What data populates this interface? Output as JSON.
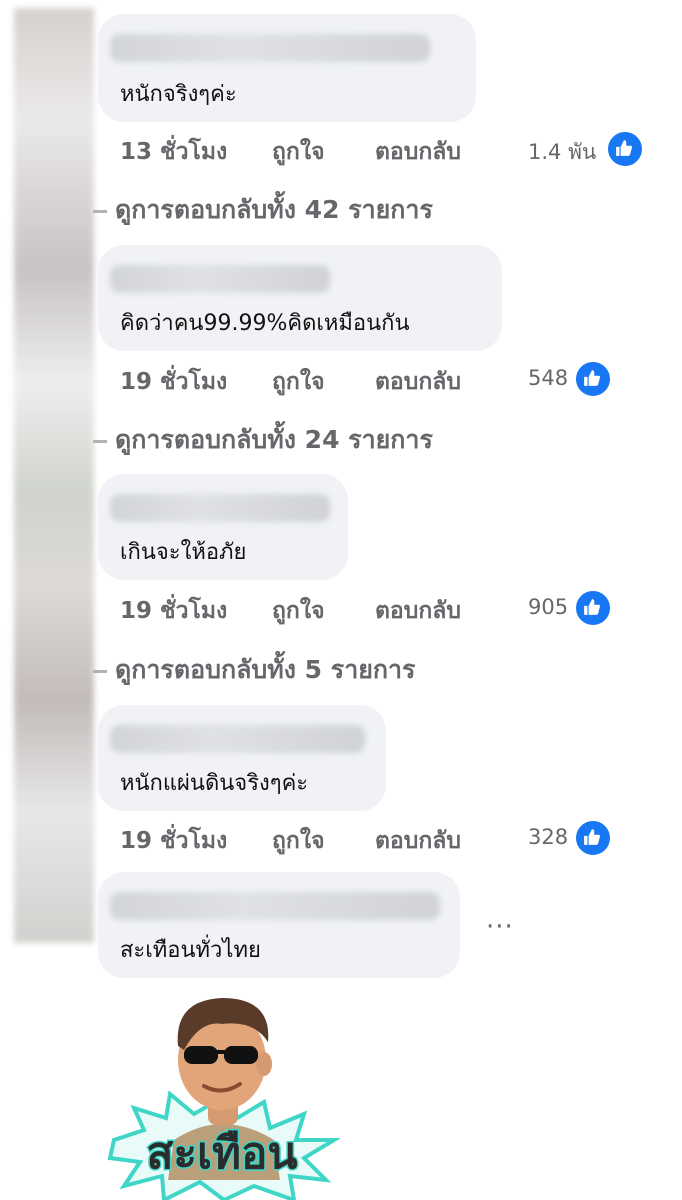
{
  "comments": [
    {
      "text": "หนักจริงๆค่ะ",
      "time": "13 ชั่วโมง",
      "like_label": "ถูกใจ",
      "reply_label": "ตอบกลับ",
      "reactions": "1.4 พัน",
      "view_replies": "ดูการตอบกลับทั้ง 42 รายการ"
    },
    {
      "text": "คิดว่าคน99.99%คิดเหมือนกัน",
      "time": "19 ชั่วโมง",
      "like_label": "ถูกใจ",
      "reply_label": "ตอบกลับ",
      "reactions": "548",
      "view_replies": "ดูการตอบกลับทั้ง 24 รายการ"
    },
    {
      "text": "เกินจะให้อภัย",
      "time": "19 ชั่วโมง",
      "like_label": "ถูกใจ",
      "reply_label": "ตอบกลับ",
      "reactions": "905",
      "view_replies": "ดูการตอบกลับทั้ง 5 รายการ"
    },
    {
      "text": "หนักแผ่นดินจริงๆค่ะ",
      "time": "19 ชั่วโมง",
      "like_label": "ถูกใจ",
      "reply_label": "ตอบกลับ",
      "reactions": "328"
    },
    {
      "text": "สะเทือนทั่วไทย",
      "more_icon": "ellipsis-icon",
      "sticker_text": "สะเทือน"
    }
  ],
  "colors": {
    "bubble": "#f0f2f5",
    "meta": "#65676b",
    "like_blue": "#1877f2",
    "sticker_teal": "#3fd6c8"
  },
  "icons": {
    "reaction": "thumbs-up-icon",
    "more": "ellipsis-icon"
  }
}
